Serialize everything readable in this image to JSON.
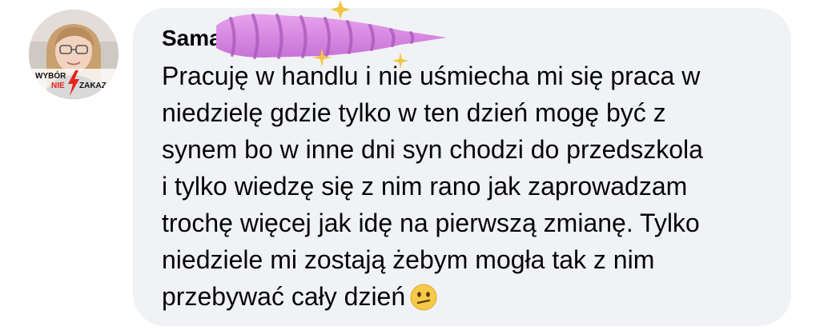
{
  "avatar": {
    "badge_line1": "WYBÓR",
    "badge_line2_left": "NIE",
    "badge_line2_right": "ZAKAZ",
    "badge_color": "#e5231b"
  },
  "comment": {
    "author": "Samanta",
    "lines": [
      "Pracuję w handlu i nie uśmiecha mi się praca w",
      "niedzielę gdzie tylko w ten dzień mogę być z",
      "synem bo w inne dni syn chodzi do przedszkola",
      "i tylko wiedzę się z nim rano jak zaprowadzam",
      "trochę więcej jak idę na pierwszą zmianę. Tylko",
      "niedziele mi zostają żebym mogła tak z nim",
      "przebywać cały dzień"
    ],
    "emoji": "confused-face",
    "bubble_color": "#f0f2f5"
  },
  "sticker": {
    "type": "unicorn-horn-sticker",
    "color": "#d98ae0"
  }
}
